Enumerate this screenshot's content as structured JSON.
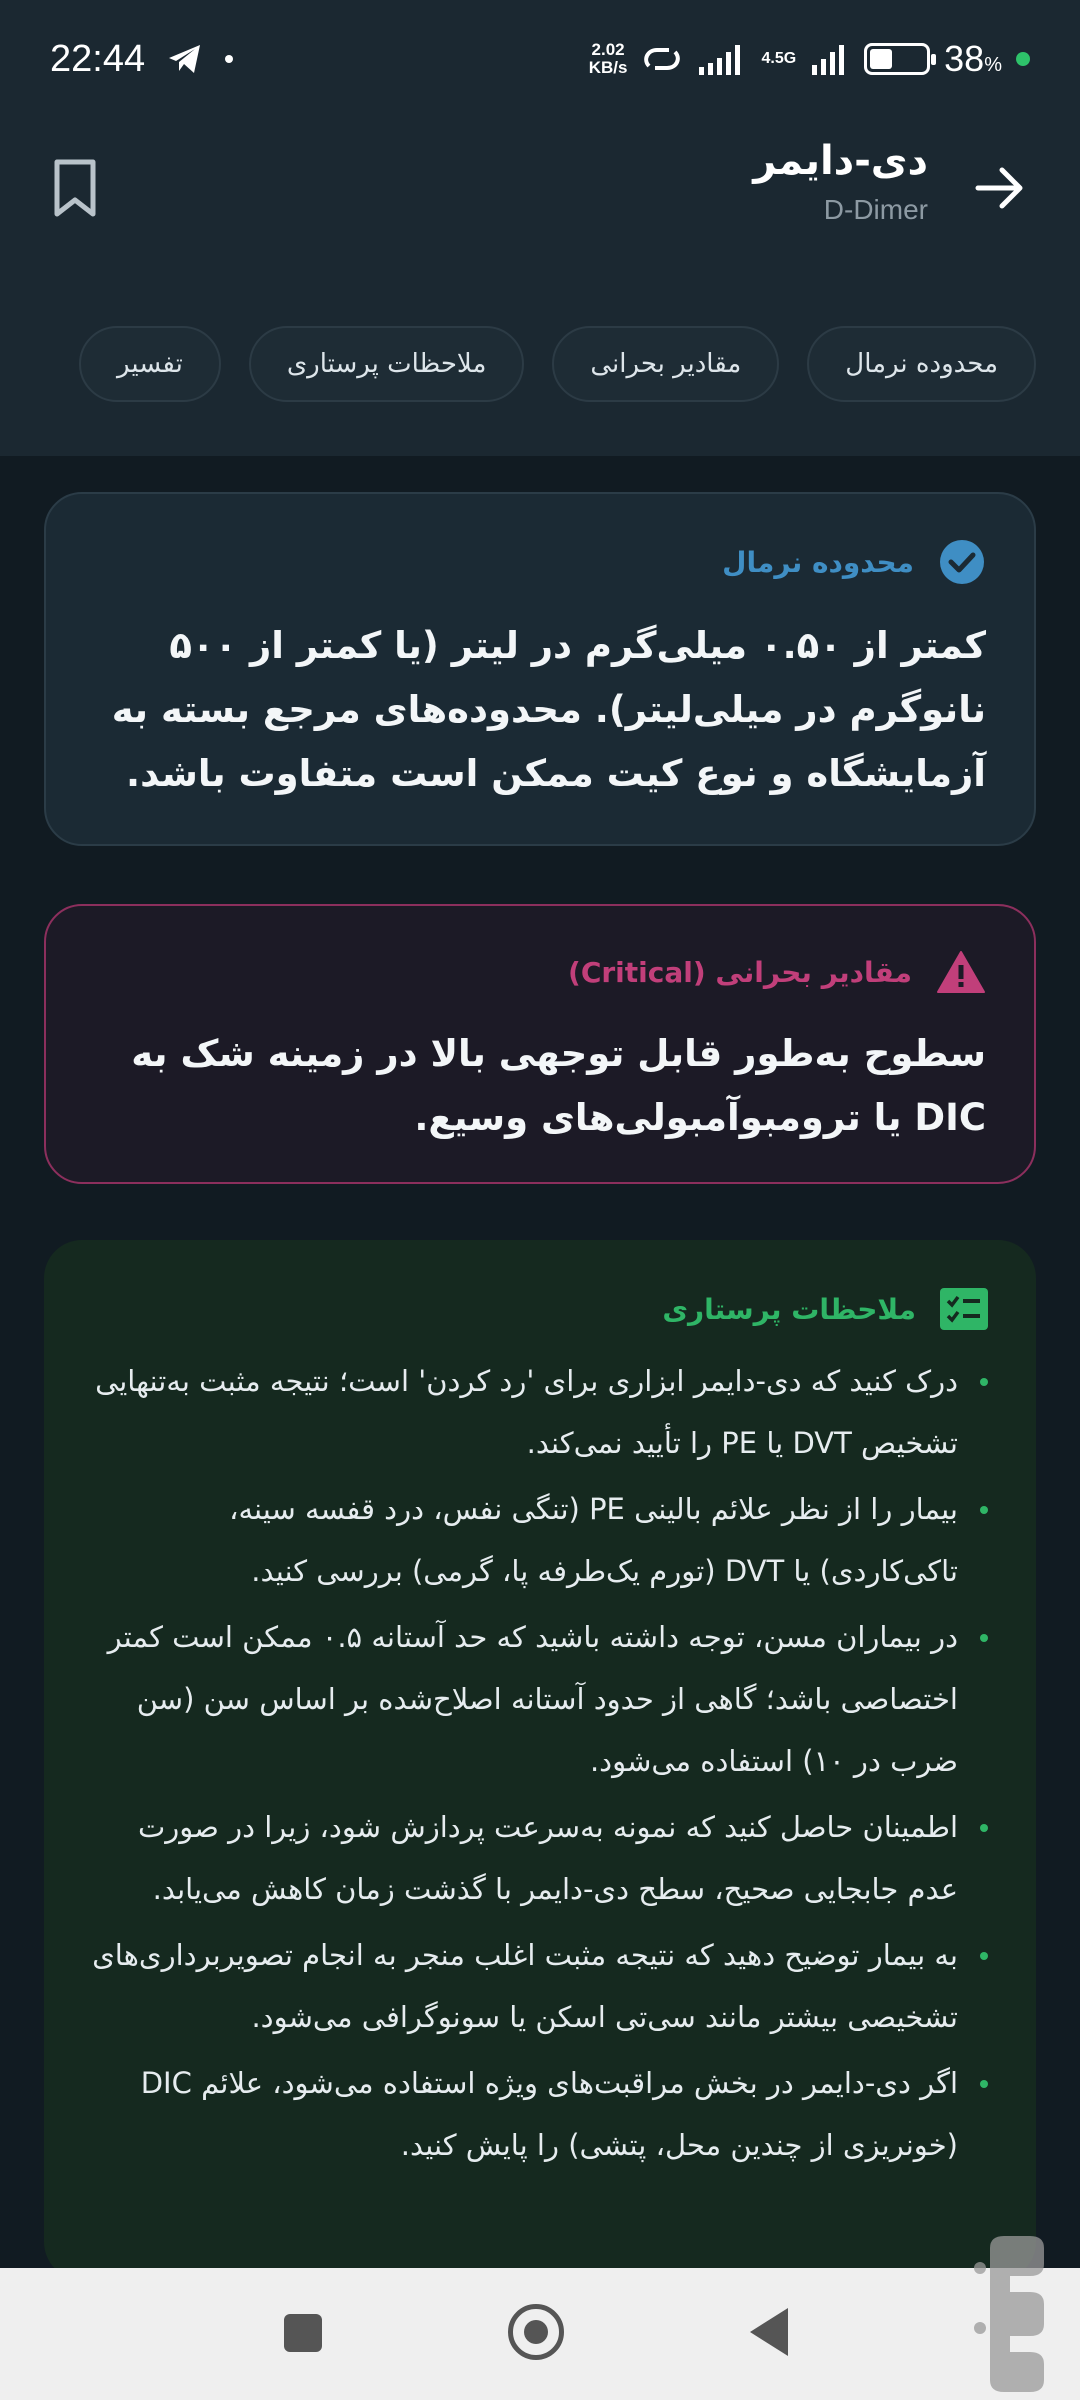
{
  "status_bar": {
    "time": "22:44",
    "net_speed_value": "2.02",
    "net_speed_unit": "KB/s",
    "network": "4.5G",
    "battery_percent": "38",
    "battery_percent_sign": "%",
    "icons": [
      "telegram-icon",
      "hotspot-icon",
      "signal-icon",
      "battery-icon"
    ]
  },
  "header": {
    "title": "دی-دایمر",
    "subtitle": "D-Dimer"
  },
  "chips": [
    {
      "label": "محدوده نرمال"
    },
    {
      "label": "مقادیر بحرانی"
    },
    {
      "label": "ملاحظات پرستاری"
    },
    {
      "label": "تفسیر"
    }
  ],
  "normal_card": {
    "title": "محدوده نرمال",
    "body": "کمتر از ۰.۵۰ میلی‌گرم در لیتر (یا کمتر از ۵۰۰ نانوگرم در میلی‌لیتر). محدوده‌های مرجع بسته به آزمایشگاه و نوع کیت ممکن است متفاوت باشد.",
    "color": "#3f8ec4"
  },
  "critical_card": {
    "title": "مقادیر بحرانی (Critical)",
    "body": "سطوح به‌طور قابل توجهی بالا در زمینه شک به DIC یا ترومبوآمبولی‌های وسیع.",
    "color": "#c13f7a"
  },
  "nursing_card": {
    "title": "ملاحظات پرستاری",
    "color": "#2fb566",
    "items": [
      "درک کنید که دی-دایمر ابزاری برای 'رد کردن' است؛ نتیجه مثبت به‌تنهایی تشخیص DVT یا PE را تأیید نمی‌کند.",
      "بیمار را از نظر علائم بالینی PE (تنگی نفس، درد قفسه سینه، تاکی‌کاردی) یا DVT (تورم یک‌طرفه پا، گرمی) بررسی کنید.",
      "در بیماران مسن، توجه داشته باشید که حد آستانه ۰.۵ ممکن است کمتر اختصاصی باشد؛ گاهی از حدود آستانه اصلاح‌شده بر اساس سن (سن ضرب در ۱۰) استفاده می‌شود.",
      "اطمینان حاصل کنید که نمونه به‌سرعت پردازش شود، زیرا در صورت عدم جابجایی صحیح، سطح دی-دایمر با گذشت زمان کاهش می‌یابد.",
      "به بیمار توضیح دهید که نتیجه مثبت اغلب منجر به انجام تصویربرداری‌های تشخیصی بیشتر مانند سی‌تی اسکن یا سونوگرافی می‌شود.",
      "اگر دی-دایمر در بخش مراقبت‌های ویژه استفاده می‌شود، علائم DIC (خونریزی از چندین محل، پتشی) را پایش کنید."
    ]
  }
}
